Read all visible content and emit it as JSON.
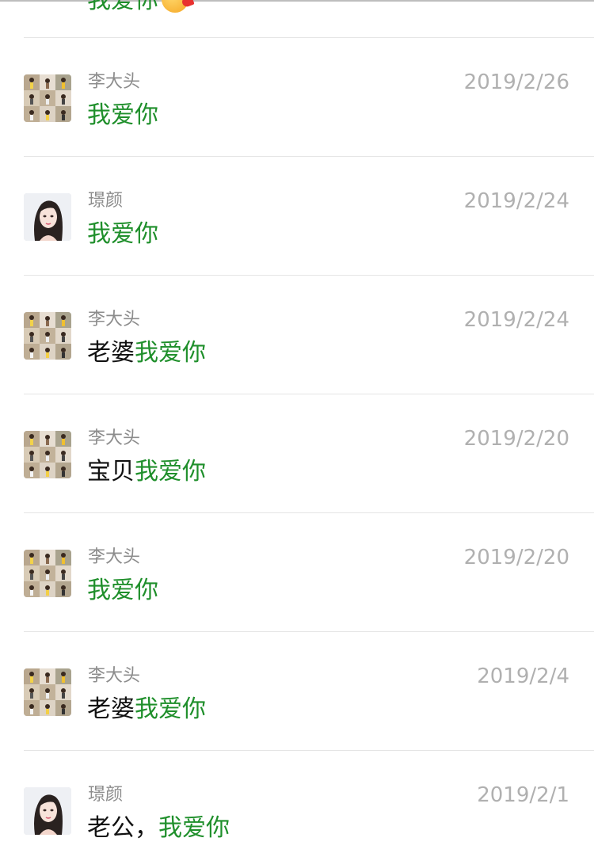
{
  "partial_top": {
    "text": "我爱你",
    "emoji": "kiss-heart-emoji"
  },
  "colors": {
    "highlight": "#1f8f2b",
    "name": "#8c8c8c",
    "date": "#b0b0b0",
    "divider": "#e5e5e5"
  },
  "rows": [
    {
      "name": "李大头",
      "date": "2019/2/26",
      "msg_prefix": "",
      "msg_highlight": "我爱你",
      "avatar": "collage-avatar"
    },
    {
      "name": "璟颜",
      "date": "2019/2/24",
      "msg_prefix": "",
      "msg_highlight": "我爱你",
      "avatar": "girl-avatar"
    },
    {
      "name": "李大头",
      "date": "2019/2/24",
      "msg_prefix": "老婆",
      "msg_highlight": "我爱你",
      "avatar": "collage-avatar"
    },
    {
      "name": "李大头",
      "date": "2019/2/20",
      "msg_prefix": "宝贝",
      "msg_highlight": "我爱你",
      "avatar": "collage-avatar"
    },
    {
      "name": "李大头",
      "date": "2019/2/20",
      "msg_prefix": "",
      "msg_highlight": "我爱你",
      "avatar": "collage-avatar"
    },
    {
      "name": "李大头",
      "date": "2019/2/4",
      "msg_prefix": "老婆",
      "msg_highlight": "我爱你",
      "avatar": "collage-avatar"
    },
    {
      "name": "璟颜",
      "date": "2019/2/1",
      "msg_prefix": "老公，",
      "msg_highlight": "我爱你",
      "avatar": "girl-avatar"
    }
  ]
}
